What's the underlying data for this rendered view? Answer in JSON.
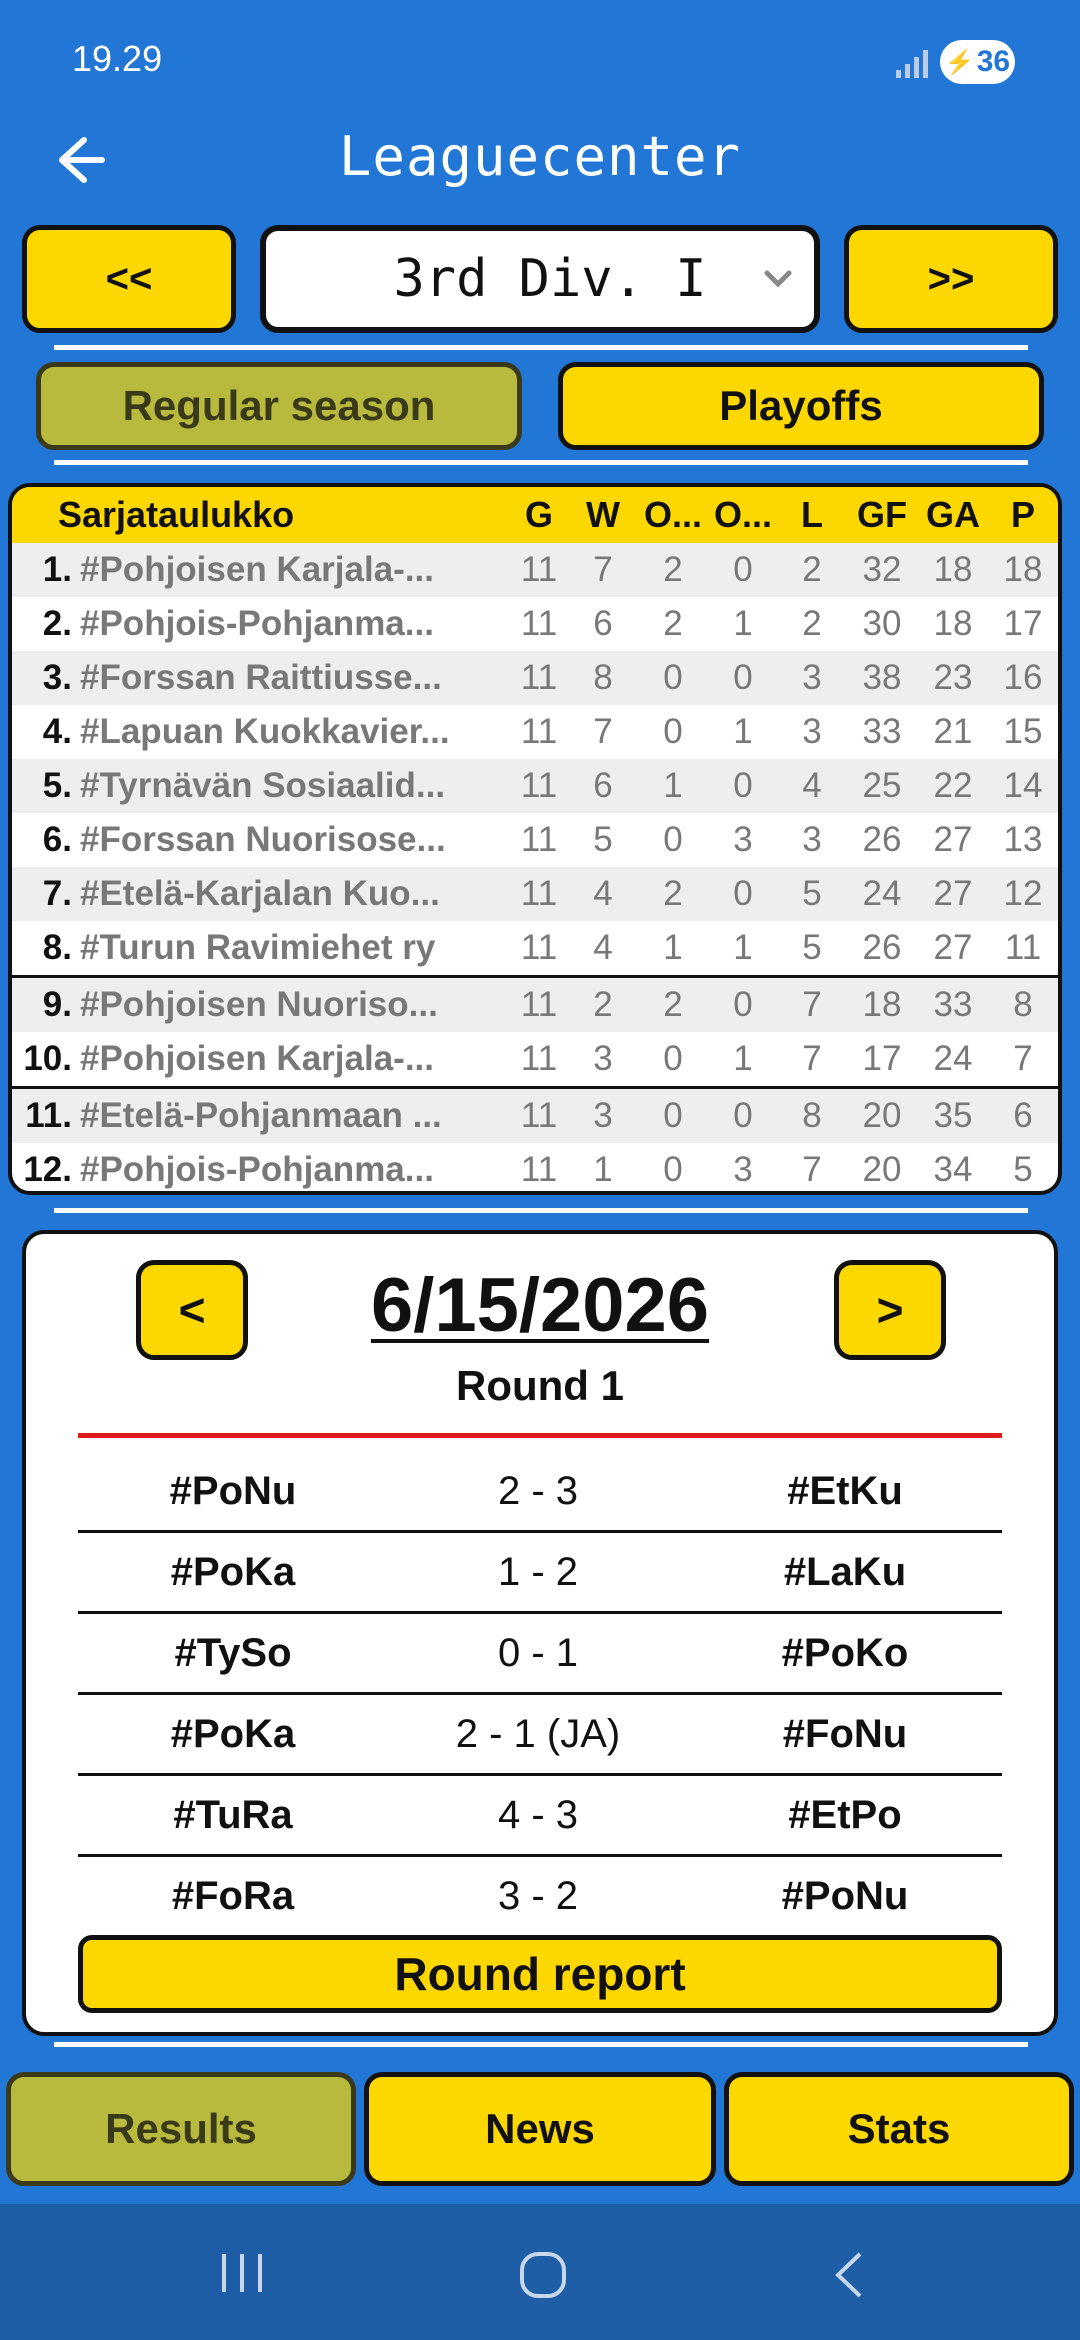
{
  "status_bar": {
    "time": "19.29",
    "battery": "36"
  },
  "header": {
    "title": "Leaguecenter"
  },
  "division": {
    "prev_label": "<<",
    "next_label": ">>",
    "selected": "3rd Div. I"
  },
  "season_tabs": {
    "regular": "Regular season",
    "playoffs": "Playoffs"
  },
  "standings": {
    "headers": {
      "name": "Sarjataulukko",
      "g": "G",
      "w": "W",
      "ow": "O...",
      "ol": "O...",
      "l": "L",
      "gf": "GF",
      "ga": "GA",
      "p": "P"
    },
    "rows": [
      {
        "rank": "1.",
        "team": "#Pohjoisen Karjala-...",
        "g": "11",
        "w": "7",
        "ow": "2",
        "ol": "0",
        "l": "2",
        "gf": "32",
        "ga": "18",
        "p": "18"
      },
      {
        "rank": "2.",
        "team": "#Pohjois-Pohjanma...",
        "g": "11",
        "w": "6",
        "ow": "2",
        "ol": "1",
        "l": "2",
        "gf": "30",
        "ga": "18",
        "p": "17"
      },
      {
        "rank": "3.",
        "team": "#Forssan Raittiusse...",
        "g": "11",
        "w": "8",
        "ow": "0",
        "ol": "0",
        "l": "3",
        "gf": "38",
        "ga": "23",
        "p": "16"
      },
      {
        "rank": "4.",
        "team": "#Lapuan Kuokkavier...",
        "g": "11",
        "w": "7",
        "ow": "0",
        "ol": "1",
        "l": "3",
        "gf": "33",
        "ga": "21",
        "p": "15"
      },
      {
        "rank": "5.",
        "team": "#Tyrnävän Sosiaalid...",
        "g": "11",
        "w": "6",
        "ow": "1",
        "ol": "0",
        "l": "4",
        "gf": "25",
        "ga": "22",
        "p": "14"
      },
      {
        "rank": "6.",
        "team": "#Forssan Nuorisose...",
        "g": "11",
        "w": "5",
        "ow": "0",
        "ol": "3",
        "l": "3",
        "gf": "26",
        "ga": "27",
        "p": "13"
      },
      {
        "rank": "7.",
        "team": "#Etelä-Karjalan Kuo...",
        "g": "11",
        "w": "4",
        "ow": "2",
        "ol": "0",
        "l": "5",
        "gf": "24",
        "ga": "27",
        "p": "12"
      },
      {
        "rank": "8.",
        "team": "#Turun Ravimiehet ry",
        "g": "11",
        "w": "4",
        "ow": "1",
        "ol": "1",
        "l": "5",
        "gf": "26",
        "ga": "27",
        "p": "11"
      },
      {
        "rank": "9.",
        "team": "#Pohjoisen Nuoriso...",
        "g": "11",
        "w": "2",
        "ow": "2",
        "ol": "0",
        "l": "7",
        "gf": "18",
        "ga": "33",
        "p": "8"
      },
      {
        "rank": "10.",
        "team": "#Pohjoisen Karjala-...",
        "g": "11",
        "w": "3",
        "ow": "0",
        "ol": "1",
        "l": "7",
        "gf": "17",
        "ga": "24",
        "p": "7"
      },
      {
        "rank": "11.",
        "team": "#Etelä-Pohjanmaan ...",
        "g": "11",
        "w": "3",
        "ow": "0",
        "ol": "0",
        "l": "8",
        "gf": "20",
        "ga": "35",
        "p": "6"
      },
      {
        "rank": "12.",
        "team": "#Pohjois-Pohjanma...",
        "g": "11",
        "w": "1",
        "ow": "0",
        "ol": "3",
        "l": "7",
        "gf": "20",
        "ga": "34",
        "p": "5"
      }
    ]
  },
  "results": {
    "prev_label": "<",
    "next_label": ">",
    "date": "6/15/2026",
    "round": "Round 1",
    "matches": [
      {
        "home": "#PoNu",
        "score": "2 - 3",
        "away": "#EtKu"
      },
      {
        "home": "#PoKa",
        "score": "1 - 2",
        "away": "#LaKu"
      },
      {
        "home": "#TySo",
        "score": "0 - 1",
        "away": "#PoKo"
      },
      {
        "home": "#PoKa",
        "score": "2 - 1 (JA)",
        "away": "#FoNu"
      },
      {
        "home": "#TuRa",
        "score": "4 - 3",
        "away": "#EtPo"
      },
      {
        "home": "#FoRa",
        "score": "3 - 2",
        "away": "#PoNu"
      }
    ],
    "report_label": "Round report"
  },
  "bottom_tabs": {
    "results": "Results",
    "news": "News",
    "stats": "Stats"
  },
  "colors": {
    "background": "#2277d6",
    "accent_yellow": "#fcd800",
    "selected_olive": "#b8ba3e",
    "divider_red": "#e01b1b"
  }
}
